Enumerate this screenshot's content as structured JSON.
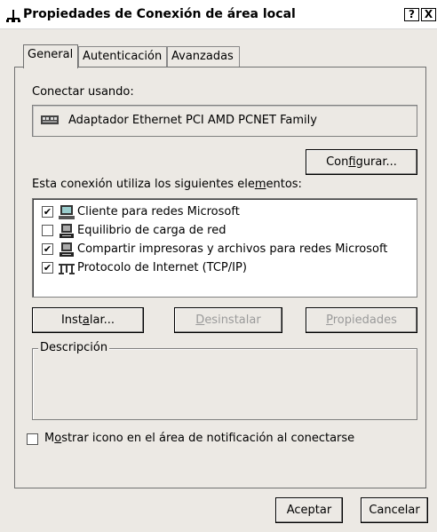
{
  "window": {
    "title": "Propiedades de Conexión de área local",
    "help_label": "?",
    "close_label": "X"
  },
  "tabs": [
    {
      "label": "General",
      "active": true
    },
    {
      "label": "Autenticación",
      "active": false
    },
    {
      "label": "Avanzadas",
      "active": false
    }
  ],
  "general": {
    "connect_using_label": "Conectar usando:",
    "adapter_name": "Adaptador Ethernet PCI AMD PCNET Family",
    "configure_button": {
      "before": "Con",
      "accel": "f",
      "after": "igurar..."
    },
    "components_label": {
      "before": "Esta conexión utiliza los siguientes ele",
      "accel": "m",
      "after": "entos:"
    },
    "components": [
      {
        "label": "Cliente para redes Microsoft",
        "checked": true,
        "icon": "network-client-icon"
      },
      {
        "label": "Equilibrio de carga de red",
        "checked": false,
        "icon": "network-service-icon"
      },
      {
        "label": "Compartir impresoras y archivos para redes Microsoft",
        "checked": true,
        "icon": "network-service-icon"
      },
      {
        "label": "Protocolo de Internet (TCP/IP)",
        "checked": true,
        "icon": "protocol-icon"
      }
    ],
    "install_button": {
      "before": "Inst",
      "accel": "a",
      "after": "lar..."
    },
    "uninstall_button": {
      "before": "",
      "accel": "D",
      "after": "esinstalar"
    },
    "properties_button": {
      "before": "",
      "accel": "P",
      "after": "ropiedades"
    },
    "description_label": "Descripción",
    "notify_label": {
      "before": "M",
      "accel": "o",
      "after": "strar icono en el área de notificación al conectarse"
    },
    "notify_checked": false
  },
  "footer": {
    "ok_label": "Aceptar",
    "cancel_label": "Cancelar"
  }
}
